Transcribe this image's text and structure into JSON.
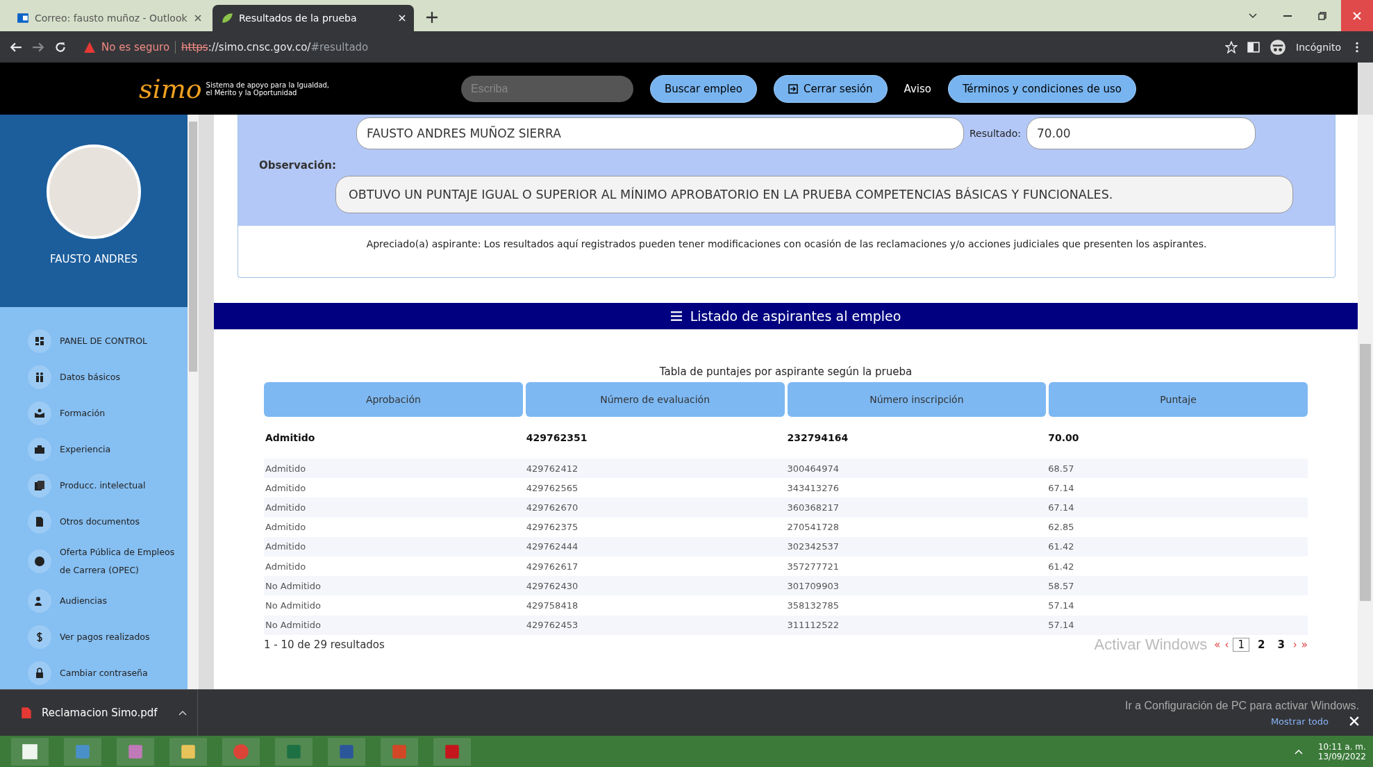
{
  "browser": {
    "tabs": [
      {
        "title": "Correo: fausto muñoz - Outlook",
        "kind": "mail",
        "selected": false
      },
      {
        "title": "Resultados de la prueba",
        "kind": "leaf",
        "selected": true
      }
    ],
    "url": {
      "warning": "No es seguro",
      "scheme": "https",
      "rest": "://simo.cnsc.gov.co/",
      "hash": "#resultado"
    },
    "profile": "Incógnito"
  },
  "site_header": {
    "logo": "simo",
    "tagline": [
      "Sistema de apoyo para la Igualdad,",
      "el Mérito y la Oportunidad"
    ],
    "search": {
      "placeholder": "Escriba"
    },
    "nav": [
      {
        "label": "Buscar empleo",
        "kind": "button"
      },
      {
        "label": "Cerrar sesión",
        "kind": "icon-button"
      },
      {
        "label": "Aviso",
        "kind": "link"
      },
      {
        "label": "Términos y condiciones de uso",
        "kind": "button"
      }
    ]
  },
  "sidebar": {
    "user_name": "FAUSTO ANDRES",
    "items": [
      {
        "label": "PANEL DE CONTROL"
      },
      {
        "label": "Datos básicos"
      },
      {
        "label": "Formación"
      },
      {
        "label": "Experiencia"
      },
      {
        "label": "Producc. intelectual"
      },
      {
        "label": "Otros documentos"
      },
      {
        "label": "Oferta Pública de Empleos de Carrera (OPEC)"
      },
      {
        "label": "Audiencias"
      },
      {
        "label": "Ver pagos realizados"
      },
      {
        "label": "Cambiar contraseña"
      }
    ]
  },
  "result": {
    "name": "FAUSTO ANDRES MUÑOZ SIERRA",
    "result_label": "Resultado:",
    "result_value": "70.00",
    "observation_label": "Observación:",
    "observation": "OBTUVO UN PUNTAJE IGUAL O SUPERIOR AL MÍNIMO APROBATORIO EN LA PRUEBA COMPETENCIAS BÁSICAS Y FUNCIONALES.",
    "notice": "Apreciado(a) aspirante: Los resultados aquí registrados pueden tener modificaciones con ocasión de las reclamaciones y/o acciones judiciales que presenten los aspirantes."
  },
  "listing": {
    "title": "Listado de aspirantes al empleo",
    "caption": "Tabla de puntajes por aspirante según la prueba",
    "columns": [
      "Aprobación",
      "Número de evaluación",
      "Número inscripción",
      "Puntaje"
    ],
    "rows": [
      {
        "cells": [
          "Admitido",
          "429762351",
          "232794164",
          "70.00"
        ],
        "current": true
      },
      {
        "cells": [
          "Admitido",
          "429762412",
          "300464974",
          "68.57"
        ],
        "current": false
      },
      {
        "cells": [
          "Admitido",
          "429762565",
          "343413276",
          "67.14"
        ],
        "current": false
      },
      {
        "cells": [
          "Admitido",
          "429762670",
          "360368217",
          "67.14"
        ],
        "current": false
      },
      {
        "cells": [
          "Admitido",
          "429762375",
          "270541728",
          "62.85"
        ],
        "current": false
      },
      {
        "cells": [
          "Admitido",
          "429762444",
          "302342537",
          "61.42"
        ],
        "current": false
      },
      {
        "cells": [
          "Admitido",
          "429762617",
          "357277721",
          "61.42"
        ],
        "current": false
      },
      {
        "cells": [
          "No Admitido",
          "429762430",
          "301709903",
          "58.57"
        ],
        "current": false
      },
      {
        "cells": [
          "No Admitido",
          "429758418",
          "358132785",
          "57.14"
        ],
        "current": false
      },
      {
        "cells": [
          "No Admitido",
          "429762453",
          "311112522",
          "57.14"
        ],
        "current": false
      }
    ],
    "summary": "1 - 10 de 29 resultados",
    "pager": {
      "first": "«",
      "prev": "‹",
      "next": "›",
      "last": "»",
      "pages": [
        {
          "label": "1",
          "selected": true
        },
        {
          "label": "2",
          "selected": false
        },
        {
          "label": "3",
          "selected": false
        }
      ]
    }
  },
  "activation": {
    "title": "Activar Windows",
    "hint": "Ir a Configuración de PC para activar Windows."
  },
  "downloads": {
    "file": "Reclamacion Simo.pdf",
    "show_all": "Mostrar todo"
  },
  "taskbar": {
    "time": "10:11 a. m.",
    "date": "13/09/2022"
  }
}
